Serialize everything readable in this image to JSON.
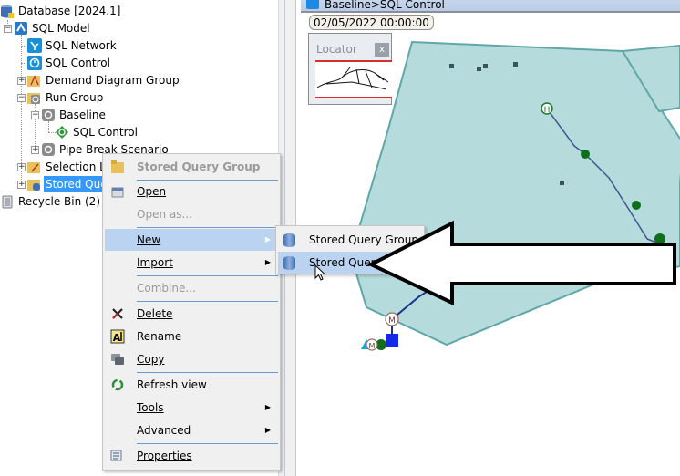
{
  "tree": {
    "items": [
      {
        "label": "Database [2024.1]",
        "icon": "database-icon"
      },
      {
        "label": "SQL Model",
        "icon": "model-icon"
      },
      {
        "label": "SQL Network",
        "icon": "network-icon"
      },
      {
        "label": "SQL Control",
        "icon": "control-icon"
      },
      {
        "label": "Demand Diagram Group",
        "icon": "demand-diagram-group-icon"
      },
      {
        "label": "Run Group",
        "icon": "run-group-icon"
      },
      {
        "label": "Baseline",
        "icon": "run-icon"
      },
      {
        "label": "SQL Control",
        "icon": "sim-control-icon"
      },
      {
        "label": "Pipe Break Scenario",
        "icon": "run-icon"
      },
      {
        "label": "Selection List Group",
        "icon": "selection-list-group-icon"
      },
      {
        "label": "Stored Query Group",
        "icon": "stored-query-group-icon",
        "selected": true
      },
      {
        "label": "Recycle Bin (2)",
        "icon": "recycle-bin-icon"
      }
    ]
  },
  "map": {
    "title": "Baseline>SQL Control",
    "timestamp": "02/05/2022 00:00:00",
    "locator": {
      "title": "Locator",
      "close": "x"
    },
    "node_labels": {
      "hydrant": "H",
      "meter": "M"
    },
    "colors": {
      "polygon_fill": "#b5dbdc",
      "polygon_stroke": "#5fa7a8",
      "pipe": "#1f3a8a",
      "node": "#0f6e1a"
    }
  },
  "context_menu": {
    "header": "Stored Query Group",
    "items": [
      {
        "label": "Open",
        "icon": "open-icon",
        "enabled": true
      },
      {
        "label": "Open as...",
        "enabled": false
      },
      {
        "label": "New",
        "enabled": true,
        "submenu": true,
        "highlighted": true
      },
      {
        "label": "Import",
        "enabled": true,
        "submenu": true
      },
      {
        "label": "Combine...",
        "enabled": false
      },
      {
        "label": "Delete",
        "icon": "delete-icon",
        "enabled": true
      },
      {
        "label": "Rename",
        "icon": "rename-icon",
        "enabled": true
      },
      {
        "label": "Copy",
        "icon": "copy-icon",
        "enabled": true
      },
      {
        "label": "Refresh view",
        "icon": "refresh-icon",
        "enabled": true
      },
      {
        "label": "Tools",
        "enabled": true,
        "submenu": true
      },
      {
        "label": "Advanced",
        "enabled": true,
        "submenu": true
      },
      {
        "label": "Properties",
        "icon": "properties-icon",
        "enabled": true
      }
    ]
  },
  "submenu": {
    "items": [
      {
        "label": "Stored Query Group",
        "icon": "database-icon"
      },
      {
        "label": "Stored Query",
        "icon": "database-icon",
        "highlighted": true
      }
    ]
  },
  "annotation": {
    "type": "callout-arrow",
    "points_to": "Stored Query"
  }
}
